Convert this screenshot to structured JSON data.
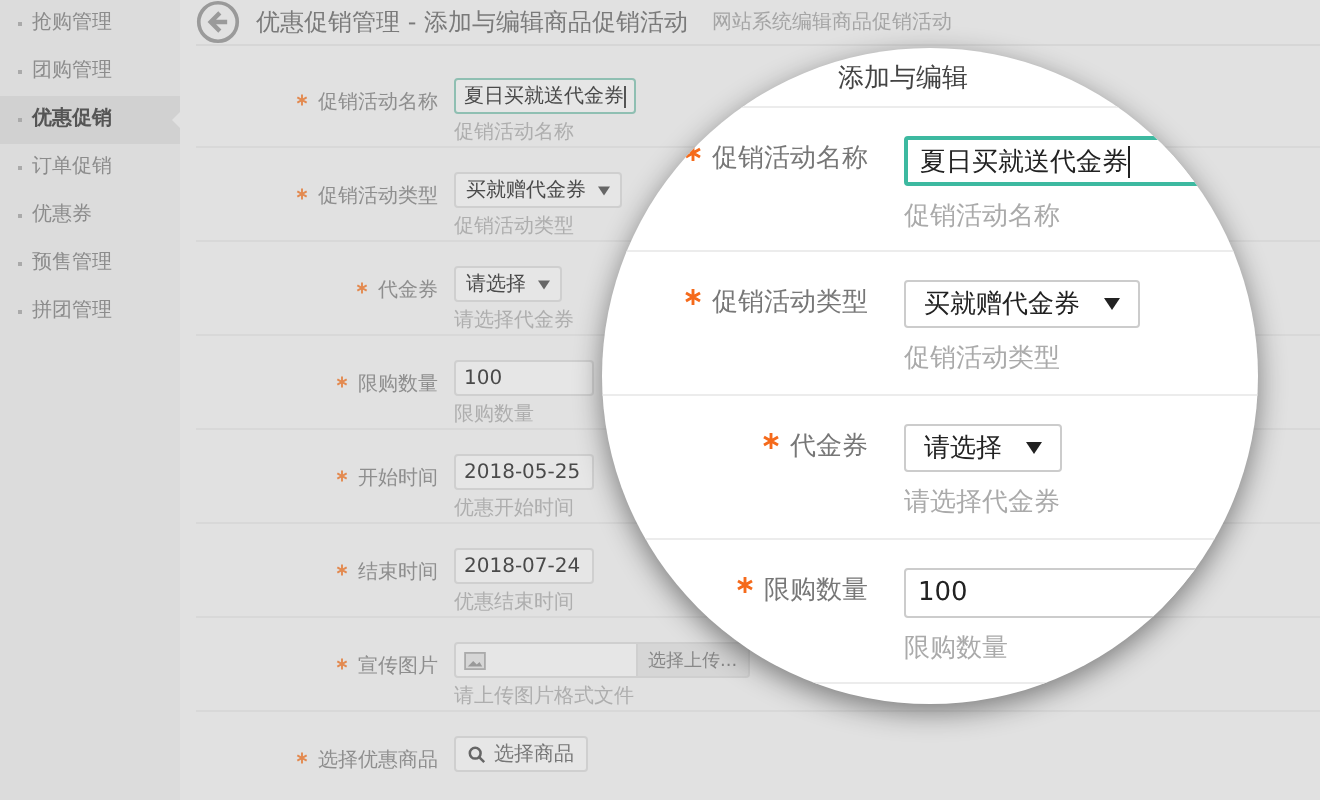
{
  "sidebar": {
    "items": [
      {
        "label": "抢购管理",
        "selected": false
      },
      {
        "label": "团购管理",
        "selected": false
      },
      {
        "label": "优惠促销",
        "selected": true
      },
      {
        "label": "订单促销",
        "selected": false
      },
      {
        "label": "优惠券",
        "selected": false
      },
      {
        "label": "预售管理",
        "selected": false
      },
      {
        "label": "拼团管理",
        "selected": false
      }
    ]
  },
  "header": {
    "title": "优惠促销管理 - 添加与编辑商品促销活动",
    "subtitle": "网站系统编辑商品促销活动"
  },
  "form": {
    "fields": [
      {
        "kind": "text",
        "label": "促销活动名称",
        "required": true,
        "value": "夏日买就送代金券",
        "focused": true,
        "hint": "促销活动名称"
      },
      {
        "kind": "select",
        "label": "促销活动类型",
        "required": true,
        "value": "买就赠代金券",
        "hint": "促销活动类型"
      },
      {
        "kind": "select",
        "label": "代金券",
        "required": true,
        "value": "请选择",
        "hint": "请选择代金券"
      },
      {
        "kind": "text",
        "label": "限购数量",
        "required": true,
        "value": "100",
        "focused": false,
        "hint": "限购数量"
      },
      {
        "kind": "text",
        "label": "开始时间",
        "required": true,
        "value": "2018-05-25",
        "focused": false,
        "hint": "优惠开始时间"
      },
      {
        "kind": "text",
        "label": "结束时间",
        "required": true,
        "value": "2018-07-24",
        "focused": false,
        "hint": "优惠结束时间"
      },
      {
        "kind": "file",
        "label": "宣传图片",
        "required": true,
        "button": "选择上传...",
        "hint": "请上传图片格式文件"
      },
      {
        "kind": "picker",
        "label": "选择优惠商品",
        "required": true,
        "button": "选择商品"
      }
    ]
  },
  "magnifier": {
    "heading": "添加与编辑",
    "fields": [
      {
        "kind": "text",
        "label": "促销活动名称",
        "required": true,
        "value": "夏日买就送代金券",
        "focused": true,
        "hint": "促销活动名称"
      },
      {
        "kind": "select",
        "label": "促销活动类型",
        "required": true,
        "value": "买就赠代金券",
        "hint": "促销活动类型"
      },
      {
        "kind": "select",
        "label": "代金券",
        "required": true,
        "value": "请选择",
        "hint": "请选择代金券"
      },
      {
        "kind": "text",
        "label": "限购数量",
        "required": true,
        "value": "100",
        "focused": false,
        "hint": "限购数量"
      }
    ]
  }
}
